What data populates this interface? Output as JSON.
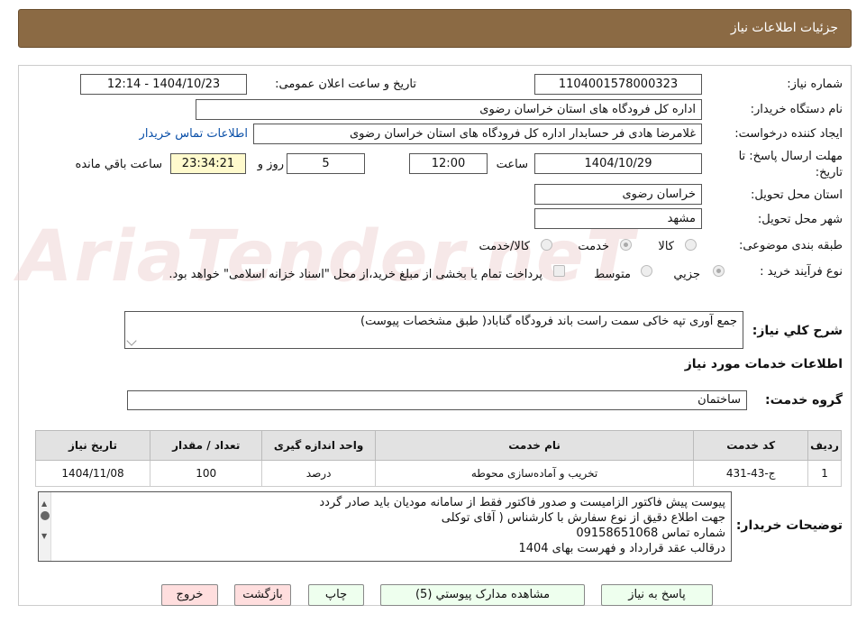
{
  "header": {
    "title": "جزئیات اطلاعات نیاز"
  },
  "fields": {
    "need_number_label": "شماره نیاز:",
    "need_number": "1104001578000323",
    "announce_label": "تاریخ و ساعت اعلان عمومی:",
    "announce_value": "1404/10/23 - 12:14",
    "buyer_org_label": "نام دستگاه خریدار:",
    "buyer_org": "اداره کل فرودگاه های استان خراسان رضوی",
    "requester_label": "ایجاد کننده درخواست:",
    "requester": "غلامرضا هادی فر حسابدار اداره کل فرودگاه های استان خراسان رضوی",
    "contact_link": "اطلاعات تماس خریدار",
    "deadline_label_1": "مهلت ارسال پاسخ: تا",
    "deadline_label_2": "تاریخ:",
    "deadline_date": "1404/10/29",
    "time_label": "ساعت",
    "deadline_time": "12:00",
    "days_value": "5",
    "days_label": "روز و",
    "remaining_time": "23:34:21",
    "remaining_label": "ساعت باقي مانده",
    "province_label": "استان محل تحویل:",
    "province": "خراسان رضوی",
    "city_label": "شهر محل تحویل:",
    "city": "مشهد",
    "category_label": "طبقه بندی موضوعی:",
    "cat_goods": "کالا",
    "cat_service": "خدمت",
    "cat_goods_service": "کالا/خدمت",
    "process_label": "نوع فرآیند خرید :",
    "proc_partial": "جزيي",
    "proc_medium": "متوسط",
    "payment_note": "پرداخت تمام یا بخشی از مبلغ خرید،از محل \"اسناد خزانه اسلامی\" خواهد بود."
  },
  "description": {
    "label": "شرح کلي نياز:",
    "text": "جمع آوری تپه خاکی سمت راست باند فرودگاه گناباد( طبق مشخصات پیوست)"
  },
  "services": {
    "section_title": "اطلاعات خدمات مورد نياز",
    "group_label": "گروه خدمت:",
    "group_value": "ساختمان",
    "columns": [
      "ردیف",
      "کد خدمت",
      "نام خدمت",
      "واحد اندازه گیری",
      "تعداد / مقدار",
      "تاريخ نياز"
    ],
    "rows": [
      [
        "1",
        "ج-43-431",
        "تخریب و آماده‌سازی محوطه",
        "درصد",
        "100",
        "1404/11/08"
      ]
    ]
  },
  "buyer_notes": {
    "label": "توضیحات خریدار:",
    "lines": [
      "پیوست پیش فاکتور الزامیست و صدور فاکتور فقط از سامانه مودیان باید صادر گردد",
      "جهت اطلاع دقیق از نوع سفارش با کارشناس  ( آقای توکلی",
      "شماره تماس 09158651068",
      "درقالب عقد قرارداد و فهرست بهای 1404"
    ]
  },
  "buttons": {
    "reply": "پاسخ به نیاز",
    "attachments": "مشاهده مدارک پیوستي (5)",
    "print": "چاپ",
    "back": "بازگشت",
    "exit": "خروج"
  },
  "watermark": "AriaTender.neT",
  "colors": {
    "header_bg": "#8b6a44",
    "link": "#0a4fa8",
    "remaining_bg": "#fffacd"
  }
}
